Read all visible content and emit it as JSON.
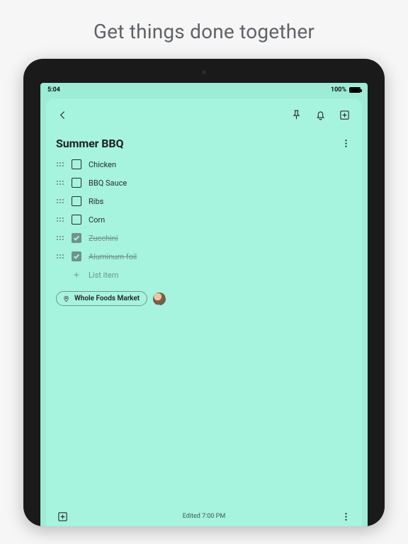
{
  "promo": {
    "headline": "Get things done together"
  },
  "statusbar": {
    "time": "5:04",
    "battery_pct": "100%"
  },
  "toolbar": {
    "back_icon": "back-icon",
    "pin_icon": "pin-icon",
    "reminder_icon": "bell-icon",
    "archive_icon": "archive-icon"
  },
  "note": {
    "title": "Summer BBQ",
    "items": [
      {
        "label": "Chicken",
        "checked": false
      },
      {
        "label": "BBQ Sauce",
        "checked": false
      },
      {
        "label": "Ribs",
        "checked": false
      },
      {
        "label": "Corn",
        "checked": false
      },
      {
        "label": "Zucchini",
        "checked": true
      },
      {
        "label": "Aluminum foil",
        "checked": true
      }
    ],
    "add_placeholder": "List item",
    "location_chip": "Whole Foods Market"
  },
  "footer": {
    "edited": "Edited 7:00 PM"
  },
  "colors": {
    "note_bg": "#a6f3de",
    "screen_bg": "#9cecd6"
  }
}
